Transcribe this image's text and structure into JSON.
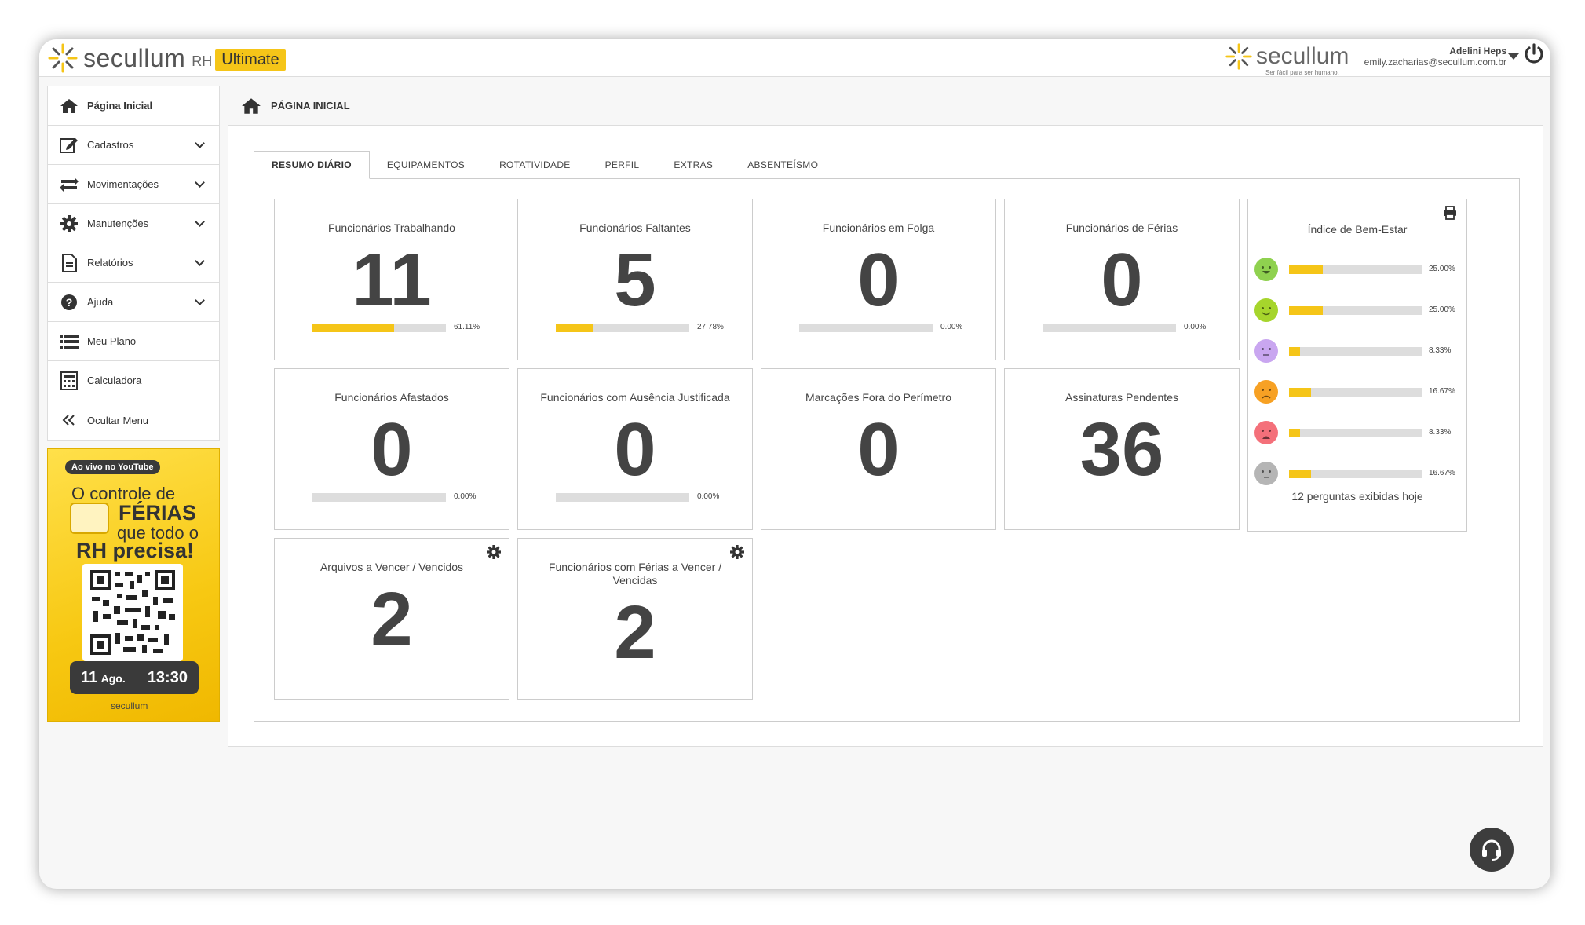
{
  "app": {
    "brand": "secullum",
    "product": "RH",
    "edition": "Ultimate",
    "brand_right": "secullum",
    "brand_tagline": "Ser fácil para ser humano."
  },
  "user": {
    "name": "Adelini Heps",
    "email": "emily.zacharias@secullum.com.br"
  },
  "sidebar": {
    "items": [
      {
        "label": "Página Inicial",
        "icon": "home-icon"
      },
      {
        "label": "Cadastros",
        "icon": "edit-icon"
      },
      {
        "label": "Movimentações",
        "icon": "swap-icon"
      },
      {
        "label": "Manutenções",
        "icon": "gear-icon"
      },
      {
        "label": "Relatórios",
        "icon": "document-icon"
      },
      {
        "label": "Ajuda",
        "icon": "help-icon"
      },
      {
        "label": "Meu Plano",
        "icon": "list-icon"
      },
      {
        "label": "Calculadora",
        "icon": "calculator-icon"
      },
      {
        "label": "Ocultar Menu",
        "icon": "double-chevron-left-icon"
      }
    ]
  },
  "promo": {
    "live": "Ao vivo no YouTube",
    "line1": "O controle de",
    "line2": "FÉRIAS",
    "line3": "que todo o",
    "line4": "RH precisa!",
    "day": "11",
    "month": "Ago.",
    "time": "13:30",
    "brand": "secullum"
  },
  "page": {
    "title": "PÁGINA INICIAL"
  },
  "tabs": [
    "RESUMO DIÁRIO",
    "EQUIPAMENTOS",
    "ROTATIVIDADE",
    "PERFIL",
    "EXTRAS",
    "ABSENTEÍSMO"
  ],
  "cards": [
    {
      "title": "Funcionários Trabalhando",
      "value": "11",
      "percent": 61.11,
      "percent_label": "61.11%"
    },
    {
      "title": "Funcionários Faltantes",
      "value": "5",
      "percent": 27.78,
      "percent_label": "27.78%"
    },
    {
      "title": "Funcionários em Folga",
      "value": "0",
      "percent": 0,
      "percent_label": "0.00%"
    },
    {
      "title": "Funcionários de Férias",
      "value": "0",
      "percent": 0,
      "percent_label": "0.00%"
    },
    {
      "title": "Funcionários Afastados",
      "value": "0",
      "percent": 0,
      "percent_label": "0.00%"
    },
    {
      "title": "Funcionários com Ausência Justificada",
      "value": "0",
      "percent": 0,
      "percent_label": "0.00%"
    },
    {
      "title": "Marcações Fora do Perímetro",
      "value": "0"
    },
    {
      "title": "Assinaturas Pendentes",
      "value": "36"
    },
    {
      "title": "Arquivos a Vencer / Vencidos",
      "value": "2"
    },
    {
      "title": "Funcionários com Férias a Vencer / Vencidas",
      "value": "2"
    }
  ],
  "wellbeing": {
    "title": "Índice de Bem-Estar",
    "rows": [
      {
        "mood": "very-happy",
        "color": "#8fd14f",
        "percent": 25.0,
        "label": "25.00%"
      },
      {
        "mood": "happy",
        "color": "#a6d52c",
        "percent": 25.0,
        "label": "25.00%"
      },
      {
        "mood": "neutral",
        "color": "#c9a6f0",
        "percent": 8.33,
        "label": "8.33%"
      },
      {
        "mood": "sad",
        "color": "#f7a124",
        "percent": 16.67,
        "label": "16.67%"
      },
      {
        "mood": "very-sad",
        "color": "#f4707a",
        "percent": 8.33,
        "label": "8.33%"
      },
      {
        "mood": "no-answer",
        "color": "#b5b5b5",
        "percent": 16.67,
        "label": "16.67%"
      }
    ],
    "footer": "12 perguntas exibidas hoje"
  },
  "colors": {
    "accent": "#f5c518",
    "bar_bg": "#dddddd",
    "text": "#444444"
  }
}
